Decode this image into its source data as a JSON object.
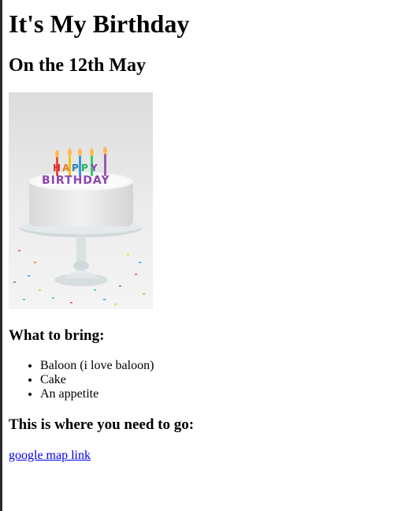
{
  "page": {
    "heading": "It's My Birthday",
    "subheading": "On the 12th May",
    "cake_image": {
      "alt": "birthday cake",
      "candle_letters": "HAPPY BIRTHDAY"
    },
    "bring_heading": "What to bring:",
    "bring_items": [
      "Baloon (i love baloon)",
      "Cake",
      "An appetite"
    ],
    "location_heading": "This is where you need to go:",
    "map_link": "google map link"
  },
  "colors": {
    "link": "#0000ee",
    "text": "#000000",
    "background": "#ffffff"
  }
}
